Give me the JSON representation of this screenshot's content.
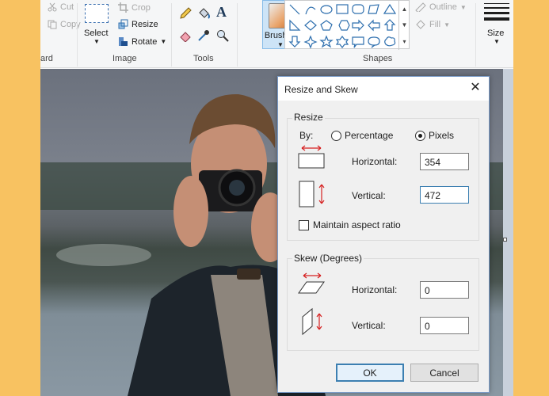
{
  "ribbon": {
    "clipboard": {
      "cut_label": "Cut",
      "copy_label": "Copy",
      "group_label": "ard"
    },
    "image": {
      "select_label": "Select",
      "crop_label": "Crop",
      "resize_label": "Resize",
      "rotate_label": "Rotate",
      "group_label": "Image"
    },
    "tools": {
      "group_label": "Tools",
      "text_glyph": "A"
    },
    "brushes": {
      "label": "Brushes"
    },
    "shapes": {
      "outline_label": "Outline",
      "fill_label": "Fill",
      "group_label": "Shapes"
    },
    "size": {
      "label": "Size"
    }
  },
  "dialog": {
    "title": "Resize and Skew",
    "close_glyph": "✕",
    "resize": {
      "legend": "Resize",
      "by_label": "By:",
      "percentage_label": "Percentage",
      "pixels_label": "Pixels",
      "selected_unit": "Pixels",
      "horizontal_label": "Horizontal:",
      "horizontal_value": "354",
      "vertical_label": "Vertical:",
      "vertical_value": "472",
      "maintain_label": "Maintain aspect ratio",
      "maintain_checked": false
    },
    "skew": {
      "legend": "Skew (Degrees)",
      "horizontal_label": "Horizontal:",
      "horizontal_value": "0",
      "vertical_label": "Vertical:",
      "vertical_value": "0"
    },
    "ok_label": "OK",
    "cancel_label": "Cancel"
  },
  "colors": {
    "accent": "#3c7fb1",
    "background": "#f8c261",
    "arrow_red": "#d62020"
  }
}
